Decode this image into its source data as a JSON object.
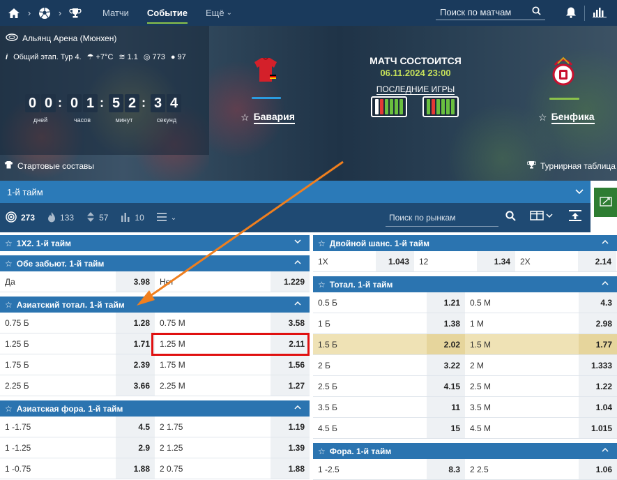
{
  "nav": {
    "items": [
      {
        "label": "Матчи",
        "active": false
      },
      {
        "label": "Событие",
        "active": true
      },
      {
        "label": "Ещё",
        "active": false
      }
    ],
    "search_placeholder": "Поиск по матчам"
  },
  "hero": {
    "venue": "Альянц Арена (Мюнхен)",
    "stage": "Общий этап. Тур 4.",
    "temp": "+7°C",
    "wind": "1.1",
    "pressure": "773",
    "humidity": "97",
    "timer": {
      "days": [
        "0",
        "0"
      ],
      "hours": [
        "0",
        "1"
      ],
      "minutes": [
        "5",
        "2"
      ],
      "seconds": [
        "3",
        "4"
      ],
      "labels": {
        "days": "дней",
        "hours": "часов",
        "minutes": "минут",
        "seconds": "секунд"
      }
    },
    "status": "МАТЧ СОСТОИТСЯ",
    "datetime": "06.11.2024 23:00",
    "last_games": "ПОСЛЕДНИЕ ИГРЫ",
    "home": "Бавария",
    "away": "Бенфика",
    "home_form": [
      "#ffffff",
      "#e53935",
      "#6abf3f",
      "#6abf3f",
      "#6abf3f",
      "#6abf3f"
    ],
    "away_form": [
      "#6abf3f",
      "#e53935",
      "#6abf3f",
      "#6abf3f",
      "#6abf3f",
      "#6abf3f"
    ],
    "lineups": "Стартовые составы",
    "standings": "Турнирная таблица"
  },
  "period": "1-й тайм",
  "filters": {
    "all": "273",
    "hot": "133",
    "updown": "57",
    "stats": "10",
    "market_search": "Поиск по рынкам"
  },
  "left_markets": [
    {
      "title": "1X2. 1-й тайм",
      "collapsed": true,
      "rows": []
    },
    {
      "title": "Обе забьют. 1-й тайм",
      "collapsed": false,
      "rows": [
        [
          {
            "l": "Да",
            "o": "3.98"
          },
          {
            "l": "Нет",
            "o": "1.229"
          }
        ]
      ]
    },
    {
      "title": "Азиатский тотал. 1-й тайм",
      "collapsed": false,
      "rows": [
        [
          {
            "l": "0.75 Б",
            "o": "1.28"
          },
          {
            "l": "0.75 М",
            "o": "3.58"
          }
        ],
        [
          {
            "l": "1.25 Б",
            "o": "1.71"
          },
          {
            "l": "1.25 М",
            "o": "2.11"
          }
        ],
        [
          {
            "l": "1.75 Б",
            "o": "2.39"
          },
          {
            "l": "1.75 М",
            "o": "1.56"
          }
        ],
        [
          {
            "l": "2.25 Б",
            "o": "3.66"
          },
          {
            "l": "2.25 М",
            "o": "1.27"
          }
        ]
      ]
    },
    {
      "title": "Азиатская фора. 1-й тайм",
      "collapsed": false,
      "rows": [
        [
          {
            "l": "1 -1.75",
            "o": "4.5"
          },
          {
            "l": "2 1.75",
            "o": "1.19"
          }
        ],
        [
          {
            "l": "1 -1.25",
            "o": "2.9"
          },
          {
            "l": "2 1.25",
            "o": "1.39"
          }
        ],
        [
          {
            "l": "1 -0.75",
            "o": "1.88"
          },
          {
            "l": "2 0.75",
            "o": "1.88"
          }
        ]
      ]
    }
  ],
  "right_markets": [
    {
      "title": "Двойной шанс. 1-й тайм",
      "rows": [
        [
          {
            "l": "1X",
            "o": "1.043"
          },
          {
            "l": "12",
            "o": "1.34"
          },
          {
            "l": "2X",
            "o": "2.14"
          }
        ]
      ]
    },
    {
      "title": "Тотал. 1-й тайм",
      "rows": [
        [
          {
            "l": "0.5 Б",
            "o": "1.21"
          },
          {
            "l": "0.5 М",
            "o": "4.3"
          }
        ],
        [
          {
            "l": "1 Б",
            "o": "1.38"
          },
          {
            "l": "1 М",
            "o": "2.98"
          }
        ],
        [
          {
            "l": "1.5 Б",
            "o": "2.02"
          },
          {
            "l": "1.5 М",
            "o": "1.77"
          }
        ],
        [
          {
            "l": "2 Б",
            "o": "3.22"
          },
          {
            "l": "2 М",
            "o": "1.333"
          }
        ],
        [
          {
            "l": "2.5 Б",
            "o": "4.15"
          },
          {
            "l": "2.5 М",
            "o": "1.22"
          }
        ],
        [
          {
            "l": "3.5 Б",
            "o": "11"
          },
          {
            "l": "3.5 М",
            "o": "1.04"
          }
        ],
        [
          {
            "l": "4.5 Б",
            "o": "15"
          },
          {
            "l": "4.5 М",
            "o": "1.015"
          }
        ]
      ]
    },
    {
      "title": "Фора. 1-й тайм",
      "rows": [
        [
          {
            "l": "1 -2.5",
            "o": "8.3"
          },
          {
            "l": "2 2.5",
            "o": "1.06"
          }
        ]
      ]
    }
  ],
  "colors": {
    "nav": "#1a3a5c",
    "accent": "#2b74b0",
    "highlight_row": "#efe2b5",
    "annotation_box": "#e01010",
    "arrow": "#f07f1e"
  }
}
